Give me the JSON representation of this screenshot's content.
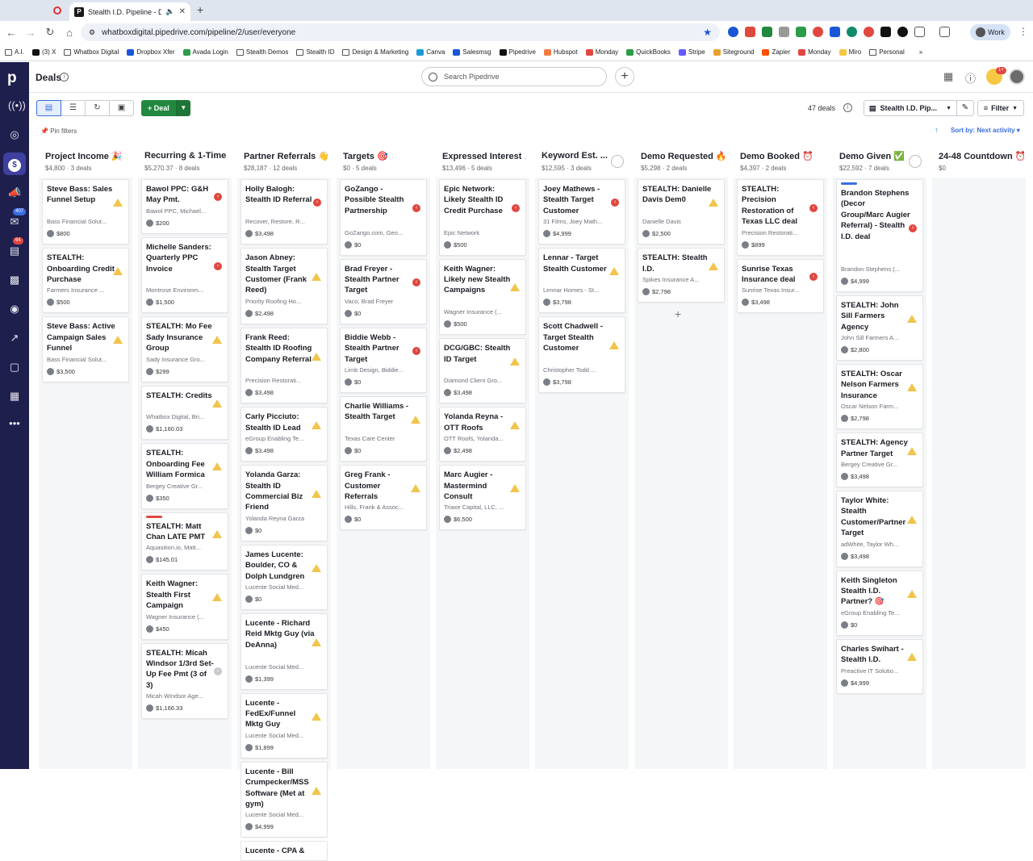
{
  "browser": {
    "tab_title": "Stealth I.D. Pipeline - Dea",
    "url": "whatboxdigital.pipedrive.com/pipeline/2/user/everyone",
    "profile_label": "Work",
    "bookmarks": [
      "A.I.",
      "(3) X",
      "Whatbox Digital",
      "Dropbox Xfer",
      "Avada Login",
      "Stealth Demos",
      "Stealth ID",
      "Design & Marketing",
      "Canva",
      "Salesmsg",
      "Pipedrive",
      "Hubspot",
      "Monday",
      "QuickBooks",
      "Stripe",
      "Siteground",
      "Zapier",
      "Monday",
      "Miro",
      "Personal"
    ]
  },
  "app": {
    "page_title": "Deals",
    "search_placeholder": "Search Pipedrive",
    "deal_button": "Deal",
    "deal_count": "47 deals",
    "pipeline_name": "Stealth I.D. Pip...",
    "filter_label": "Filter",
    "pin_filters": "Pin filters",
    "sort_by": "Sort by: Next activity",
    "nav_badges": {
      "mail": "407",
      "activities": "64",
      "bulb": "1+"
    }
  },
  "columns": [
    {
      "title": "Project Income 🎉",
      "meta": "$4,800 · 3 deals",
      "circle": false,
      "cards": [
        {
          "title": "Steve Bass: Sales Funnel Setup",
          "sub": "Bass Financial Solut...",
          "value": "$800",
          "status": "warn"
        },
        {
          "title": "STEALTH: Onboarding Credit Purchase",
          "sub": "Farmers Insurance ...",
          "value": "$500",
          "status": "warn"
        },
        {
          "title": "Steve Bass: Active Campaign Sales Funnel",
          "sub": "Bass Financial Solut...",
          "value": "$3,500",
          "status": "warn"
        }
      ]
    },
    {
      "title": "Recurring & 1-Time ...",
      "meta": "$5,270.37 · 8 deals",
      "circle": false,
      "cards": [
        {
          "title": "Bawol PPC: G&H May Pmt.",
          "sub": "Bawol PPC, Michael...",
          "value": "$200",
          "status": "over"
        },
        {
          "title": "Michelle Sanders: Quarterly PPC Invoice",
          "sub": "Montrose Environm...",
          "value": "$1,500",
          "status": "over"
        },
        {
          "title": "STEALTH: Mo Fee Sady Insurance Group",
          "sub": "Sady Insurance Gro...",
          "value": "$299",
          "status": "warn"
        },
        {
          "title": "STEALTH: Credits",
          "sub": "Whatbox Digital, Bri...",
          "value": "$1,160.03",
          "status": "warn"
        },
        {
          "title": "STEALTH: Onboarding Fee William Formica",
          "sub": "Bergey Creative Gr...",
          "value": "$350",
          "status": "warn"
        },
        {
          "title": "STEALTH: Matt Chan LATE PMT",
          "sub": "Aquasition.io, Matt...",
          "value": "$145.01",
          "status": "warn",
          "stripe": "#e0473e"
        },
        {
          "title": "Keith Wagner: Stealth First Campaign",
          "sub": "Wagner Insurance (...",
          "value": "$450",
          "status": "warn"
        },
        {
          "title": "STEALTH: Micah Windsor 1/3rd Set-Up Fee Pmt (3 of 3)",
          "sub": "Micah Windsor Age...",
          "value": "$1,166.33",
          "status": "none"
        }
      ]
    },
    {
      "title": "Partner Referrals 👋",
      "meta": "$28,187 · 12 deals",
      "circle": false,
      "cards": [
        {
          "title": "Holly Balogh: Stealth ID Referral",
          "sub": "Recover, Restore, R...",
          "value": "$3,498",
          "status": "over"
        },
        {
          "title": "Jason Abney: Stealth Target Customer (Frank Reed)",
          "sub": "Priority Roofing Ho...",
          "value": "$2,498",
          "status": "warn"
        },
        {
          "title": "Frank Reed: Stealth ID Roofing Company Referral",
          "sub": "Precision Restorati...",
          "value": "$3,498",
          "status": "warn"
        },
        {
          "title": "Carly Picciuto: Stealth ID Lead",
          "sub": "eGroup Enabling Te...",
          "value": "$3,498",
          "status": "warn"
        },
        {
          "title": "Yolanda Garza: Stealth ID Commercial Biz Friend",
          "sub": "Yolanda Reyna Garza",
          "value": "$0",
          "status": "warn"
        },
        {
          "title": "James Lucente: Boulder, CO & Dolph Lundgren",
          "sub": "Lucente Social Med...",
          "value": "$0",
          "status": "warn"
        },
        {
          "title": "Lucente - Richard Reid Mktg Guy (via DeAnna)",
          "sub": "Lucente Social Med...",
          "value": "$1,399",
          "status": "warn"
        },
        {
          "title": "Lucente - FedEx/Funnel Mktg Guy",
          "sub": "Lucente Social Med...",
          "value": "$1,899",
          "status": "warn"
        },
        {
          "title": "Lucente - Bill Crumpecker/MSS Software (Met at gym)",
          "sub": "Lucente Social Med...",
          "value": "$4,999",
          "status": "warn"
        },
        {
          "title": "Lucente - CPA &",
          "sub": "",
          "value": "",
          "status": ""
        }
      ]
    },
    {
      "title": "Targets 🎯",
      "meta": "$0 · 5 deals",
      "circle": false,
      "cards": [
        {
          "title": "GoZango - Possible Stealth Partnership",
          "sub": "GoZango.com, Geo...",
          "value": "$0",
          "status": "over"
        },
        {
          "title": "Brad Freyer - Stealth Partner Target",
          "sub": "Vaco, Brad Freyer",
          "value": "$0",
          "status": "over"
        },
        {
          "title": "Biddie Webb - Stealth Partner Target",
          "sub": "Limb Design, Biddie...",
          "value": "$0",
          "status": "over"
        },
        {
          "title": "Charlie Williams - Stealth Target",
          "sub": "Texas Care Center",
          "value": "$0",
          "status": "warn"
        },
        {
          "title": "Greg Frank - Customer Referrals",
          "sub": "Hills, Frank & Assoc...",
          "value": "$0",
          "status": "warn"
        }
      ]
    },
    {
      "title": "Expressed Interest 🙏",
      "meta": "$13,496 · 5 deals",
      "circle": false,
      "cards": [
        {
          "title": "Epic Network: Likely Stealth ID Credit Purchase",
          "sub": "Epic Network",
          "value": "$500",
          "status": "over"
        },
        {
          "title": "Keith Wagner: Likely new Stealth Campaigns",
          "sub": "Wagner Insurance (...",
          "value": "$500",
          "status": "warn"
        },
        {
          "title": "DCG/GBC: Stealth ID Target",
          "sub": "Diamond Client Gro...",
          "value": "$3,498",
          "status": "warn"
        },
        {
          "title": "Yolanda Reyna - OTT Roofs",
          "sub": "OTT Roofs, Yolanda...",
          "value": "$2,498",
          "status": "warn"
        },
        {
          "title": "Marc Augier - Mastermind Consult",
          "sub": "Triaxe Capital, LLC, ...",
          "value": "$6,500",
          "status": "warn"
        }
      ]
    },
    {
      "title": "Keyword Est. ...",
      "meta": "$12,595 · 3 deals",
      "circle": true,
      "cards": [
        {
          "title": "Joey Mathews - Stealth Target Customer",
          "sub": "31 Films, Joey Math...",
          "value": "$4,999",
          "status": "over"
        },
        {
          "title": "Lennar - Target Stealth Customer",
          "sub": "Lennar Homes - St...",
          "value": "$3,798",
          "status": "warn"
        },
        {
          "title": "Scott Chadwell - Target Stealth Customer",
          "sub": "Christopher Todd ...",
          "value": "$3,798",
          "status": "warn"
        }
      ]
    },
    {
      "title": "Demo Requested 🔥",
      "meta": "$5,298 · 2 deals",
      "circle": false,
      "add": true,
      "cards": [
        {
          "title": "STEALTH: Danielle Davis Dem0",
          "sub": "Danielle Davis",
          "value": "$2,500",
          "status": "warn"
        },
        {
          "title": "STEALTH: Stealth I.D.",
          "sub": "Spikes Insurance A...",
          "value": "$2,798",
          "status": "warn"
        }
      ]
    },
    {
      "title": "Demo Booked ⏰",
      "meta": "$4,397 · 2 deals",
      "circle": false,
      "cards": [
        {
          "title": "STEALTH: Precision Restoration of Texas LLC deal",
          "sub": "Precision Restorati...",
          "value": "$899",
          "status": "over"
        },
        {
          "title": "Sunrise Texas Insurance deal",
          "sub": "Sunrise Texas Insur...",
          "value": "$3,498",
          "status": "over"
        }
      ]
    },
    {
      "title": "Demo Given ✅",
      "meta": "$22,592 · 7 deals",
      "circle": true,
      "cards": [
        {
          "title": "Brandon Stephens (Decor Group/Marc Augier Referral) - Stealth I.D. deal",
          "sub": "Brandon Stephens (...",
          "value": "$4,999",
          "status": "over",
          "stripe": "#3b6de0"
        },
        {
          "title": "STEALTH: John Sill Farmers Agency",
          "sub": "John Sill Farmers A...",
          "value": "$2,800",
          "status": "warn"
        },
        {
          "title": "STEALTH: Oscar Nelson Farmers Insurance",
          "sub": "Oscar Nelson Farm...",
          "value": "$2,798",
          "status": "warn"
        },
        {
          "title": "STEALTH: Agency Partner Target",
          "sub": "Bergey Creative Gr...",
          "value": "$3,498",
          "status": "warn"
        },
        {
          "title": "Taylor White: Stealth Customer/Partner Target",
          "sub": "adWhite, Taylor Wh...",
          "value": "$3,498",
          "status": "warn"
        },
        {
          "title": "Keith Singleton Stealth I.D. Partner? 🎯",
          "sub": "eGroup Enabling Te...",
          "value": "$0",
          "status": "warn"
        },
        {
          "title": "Charles Swihart - Stealth I.D.",
          "sub": "Preactive IT Solutio...",
          "value": "$4,999",
          "status": "warn"
        }
      ]
    },
    {
      "title": "24-48 Countdown ⏰",
      "meta": "$0",
      "circle": false,
      "cards": []
    }
  ]
}
